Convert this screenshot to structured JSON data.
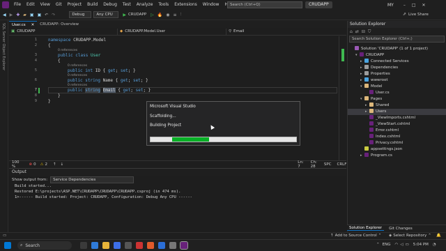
{
  "menu": [
    "File",
    "Edit",
    "View",
    "Git",
    "Project",
    "Build",
    "Debug",
    "Test",
    "Analyze",
    "Tools",
    "Extensions",
    "Window",
    "Help"
  ],
  "search": {
    "placeholder": "Search (Ctrl+Q)"
  },
  "app_name": "CRUDAPP",
  "user_initials": "MY",
  "toolbar": {
    "config": "Debug",
    "platform": "Any CPU",
    "run_label": "CRUDAPP",
    "live_share": "Live Share"
  },
  "left_rail": {
    "label": "SQL Server Object Explorer"
  },
  "tabs": [
    {
      "label": "User.cs",
      "active": true
    },
    {
      "label": "CRUDAPP: Overview",
      "active": false
    }
  ],
  "navbar": {
    "project": "CRUDAPP",
    "class": "CRUDAPP.Model.User",
    "member": "Email"
  },
  "code": {
    "line1": "namespace CRUDAPP.Model",
    "line2": "{",
    "line3": "public class User",
    "line4": "{",
    "line5": "public int ID { get; set; }",
    "line6": "public string Name { get; set; }",
    "line7": "public string Email { get; set; }",
    "line8": "}",
    "line9": "}",
    "refs0": "0 references",
    "refs1": "0 references",
    "refs2": "0 references",
    "refs3": "0 references",
    "refs4": "0 references"
  },
  "editor_status": {
    "zoom": "100 %",
    "errors": "0",
    "warnings": "2",
    "line": "Ln: 7",
    "col": "Ch: 28",
    "spc": "SPC",
    "crlf": "CRLF"
  },
  "output": {
    "title": "Output",
    "show_from_label": "Show output from:",
    "show_from_value": "Service Dependencies",
    "lines": [
      "Build started...",
      "Restored E:\\projects\\ASP.NET\\CRUDAPP\\CRUDAPP\\CRUDAPP.csproj (in 474 ms).",
      "1>------ Build started: Project: CRUDAPP, Configuration: Debug Any CPU ------"
    ]
  },
  "solution_explorer": {
    "title": "Solution Explorer",
    "search_placeholder": "Search Solution Explorer (Ctrl+;)",
    "items": [
      {
        "label": "Solution 'CRUDAPP' (1 of 1 project)",
        "icon_color": "#9b59b6"
      },
      {
        "label": "CRUDAPP",
        "icon_color": "#68217a"
      },
      {
        "label": "Connected Services",
        "icon_color": "#4aa3df"
      },
      {
        "label": "Dependencies",
        "icon_color": "#9c9c9c"
      },
      {
        "label": "Properties",
        "icon_color": "#9c9c9c"
      },
      {
        "label": "wwwroot",
        "icon_color": "#4aa3df"
      },
      {
        "label": "Model",
        "icon_color": "#dcb67a"
      },
      {
        "label": "User.cs",
        "icon_color": "#68217a"
      },
      {
        "label": "Pages",
        "icon_color": "#dcb67a"
      },
      {
        "label": "Shared",
        "icon_color": "#dcb67a"
      },
      {
        "label": "Users",
        "icon_color": "#dcb67a"
      },
      {
        "label": "_ViewImports.cshtml",
        "icon_color": "#68217a"
      },
      {
        "label": "_ViewStart.cshtml",
        "icon_color": "#68217a"
      },
      {
        "label": "Error.cshtml",
        "icon_color": "#68217a"
      },
      {
        "label": "Index.cshtml",
        "icon_color": "#68217a"
      },
      {
        "label": "Privacy.cshtml",
        "icon_color": "#68217a"
      },
      {
        "label": "appsettings.json",
        "icon_color": "#cbcb41"
      },
      {
        "label": "Program.cs",
        "icon_color": "#68217a"
      }
    ],
    "bottom_tabs": [
      "Solution Explorer",
      "Git Changes"
    ]
  },
  "statusbar": {
    "add_source": "Add to Source Control",
    "select_repo": "Select Repository"
  },
  "taskbar": {
    "search": "Search",
    "lang": "ENG",
    "time": "5:04 PM"
  },
  "dialog": {
    "title": "Microsoft Visual Studio",
    "line1": "Scaffolding...",
    "line2": "Building Project",
    "progress_start": 0.15,
    "progress_end": 0.4
  },
  "colors": {
    "accent": "#0e70c0",
    "progress": "#06b025",
    "vs_purple": "#68217a"
  }
}
